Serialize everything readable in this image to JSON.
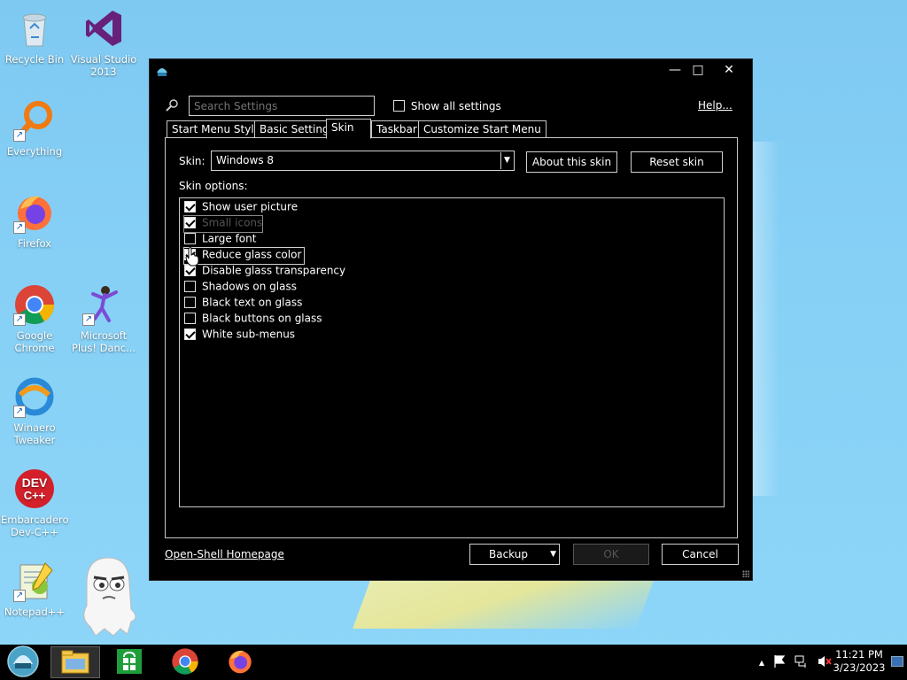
{
  "desktop": {
    "icons": [
      {
        "label": "Recycle Bin",
        "icon": "recycle-bin-icon"
      },
      {
        "label": "Visual Studio 2013",
        "icon": "visual-studio-icon"
      },
      {
        "label": "Everything",
        "icon": "everything-search-icon"
      },
      {
        "label": "Firefox",
        "icon": "firefox-icon"
      },
      {
        "label": "Google Chrome",
        "icon": "chrome-icon"
      },
      {
        "label": "Microsoft Plus! Danc...",
        "icon": "dancer-icon"
      },
      {
        "label": "Winaero Tweaker",
        "icon": "winaero-tweaker-icon"
      },
      {
        "label": "Embarcadero Dev-C++",
        "icon": "dev-cpp-icon",
        "logo_text": "DEV C++"
      },
      {
        "label": "Notepad++",
        "icon": "notepad-plus-plus-icon"
      }
    ]
  },
  "dialog": {
    "icon": "open-shell-icon",
    "window_buttons": {
      "minimize": "—",
      "maximize": "□",
      "close": "✕"
    },
    "search": {
      "placeholder": "Search Settings"
    },
    "show_all_settings": {
      "label": "Show all settings",
      "checked": false
    },
    "help_label": "Help...",
    "tabs": [
      {
        "label": "Start Menu Style",
        "active": false
      },
      {
        "label": "Basic Settings",
        "active": false
      },
      {
        "label": "Skin",
        "active": true
      },
      {
        "label": "Taskbar",
        "active": false
      },
      {
        "label": "Customize Start Menu",
        "active": false
      }
    ],
    "skin_label": "Skin:",
    "skin_value": "Windows 8",
    "about_skin_label": "About this skin",
    "reset_skin_label": "Reset skin",
    "skin_options_label": "Skin options:",
    "skin_options": [
      {
        "label": "Show user picture",
        "checked": true,
        "enabled": true
      },
      {
        "label": "Small icons",
        "checked": true,
        "enabled": false
      },
      {
        "label": "Large font",
        "checked": false,
        "enabled": true
      },
      {
        "label": "Reduce glass color",
        "checked": true,
        "enabled": true,
        "focused": true
      },
      {
        "label": "Disable glass transparency",
        "checked": true,
        "enabled": true
      },
      {
        "label": "Shadows on glass",
        "checked": false,
        "enabled": true
      },
      {
        "label": "Black text on glass",
        "checked": false,
        "enabled": true
      },
      {
        "label": "Black buttons on glass",
        "checked": false,
        "enabled": true
      },
      {
        "label": "White sub-menus",
        "checked": true,
        "enabled": true
      }
    ],
    "homepage_label": "Open-Shell Homepage",
    "backup_label": "Backup",
    "ok_label": "OK",
    "cancel_label": "Cancel"
  },
  "taskbar": {
    "start_icon": "start-orb-icon",
    "pinned": [
      {
        "icon": "file-explorer-icon",
        "active": true
      },
      {
        "icon": "store-icon",
        "active": false
      },
      {
        "icon": "chrome-icon",
        "active": false
      },
      {
        "icon": "firefox-icon",
        "active": false
      }
    ],
    "tray": {
      "chevron": "▲",
      "icons": [
        "flag-icon",
        "network-icon",
        "speaker-muted-icon"
      ]
    },
    "clock": {
      "time": "11:21 PM",
      "date": "3/23/2023"
    }
  },
  "colors": {
    "desktop_bg": "#86d0f6",
    "dialog_bg": "#000000",
    "text": "#ffffff",
    "disabled_text": "#555555"
  }
}
